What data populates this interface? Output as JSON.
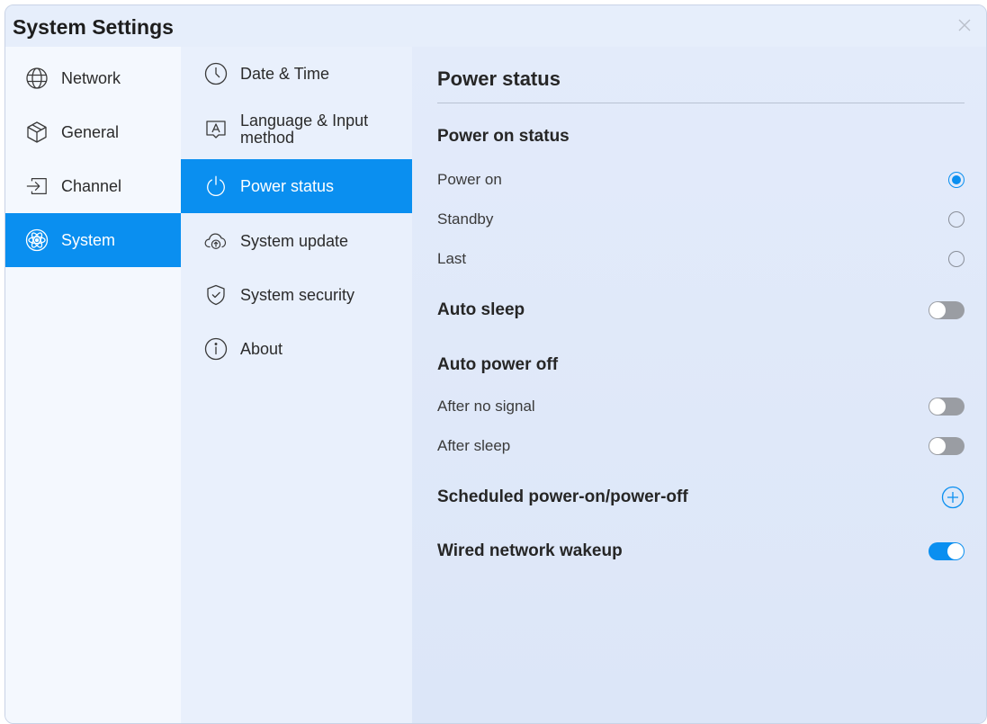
{
  "window": {
    "title": "System Settings"
  },
  "primary_nav": [
    {
      "label": "Network",
      "icon": "globe-icon",
      "active": false
    },
    {
      "label": "General",
      "icon": "cube-icon",
      "active": false
    },
    {
      "label": "Channel",
      "icon": "input-icon",
      "active": false
    },
    {
      "label": "System",
      "icon": "atom-icon",
      "active": true
    }
  ],
  "secondary_nav": [
    {
      "label": "Date & Time",
      "icon": "clock-icon",
      "active": false
    },
    {
      "label": "Language & Input method",
      "line1": "Language & Input",
      "line2": "method",
      "icon": "keyboard-a-icon",
      "active": false
    },
    {
      "label": "Power status",
      "icon": "power-icon",
      "active": true
    },
    {
      "label": "System update",
      "icon": "cloud-upload-icon",
      "active": false
    },
    {
      "label": "System security",
      "icon": "shield-check-icon",
      "active": false
    },
    {
      "label": "About",
      "icon": "info-icon",
      "active": false
    }
  ],
  "panel": {
    "title": "Power status",
    "power_on_status": {
      "title": "Power on status",
      "options": [
        {
          "label": "Power on",
          "selected": true
        },
        {
          "label": "Standby",
          "selected": false
        },
        {
          "label": "Last",
          "selected": false
        }
      ]
    },
    "auto_sleep": {
      "label": "Auto sleep",
      "enabled": false
    },
    "auto_power_off": {
      "title": "Auto power off",
      "items": [
        {
          "label": "After no signal",
          "enabled": false
        },
        {
          "label": "After sleep",
          "enabled": false
        }
      ]
    },
    "scheduled": {
      "label": "Scheduled power-on/power-off"
    },
    "wired_wakeup": {
      "label": "Wired network wakeup",
      "enabled": true
    }
  },
  "colors": {
    "accent": "#0a8ff0",
    "toggle_off": "#9a9da3"
  }
}
